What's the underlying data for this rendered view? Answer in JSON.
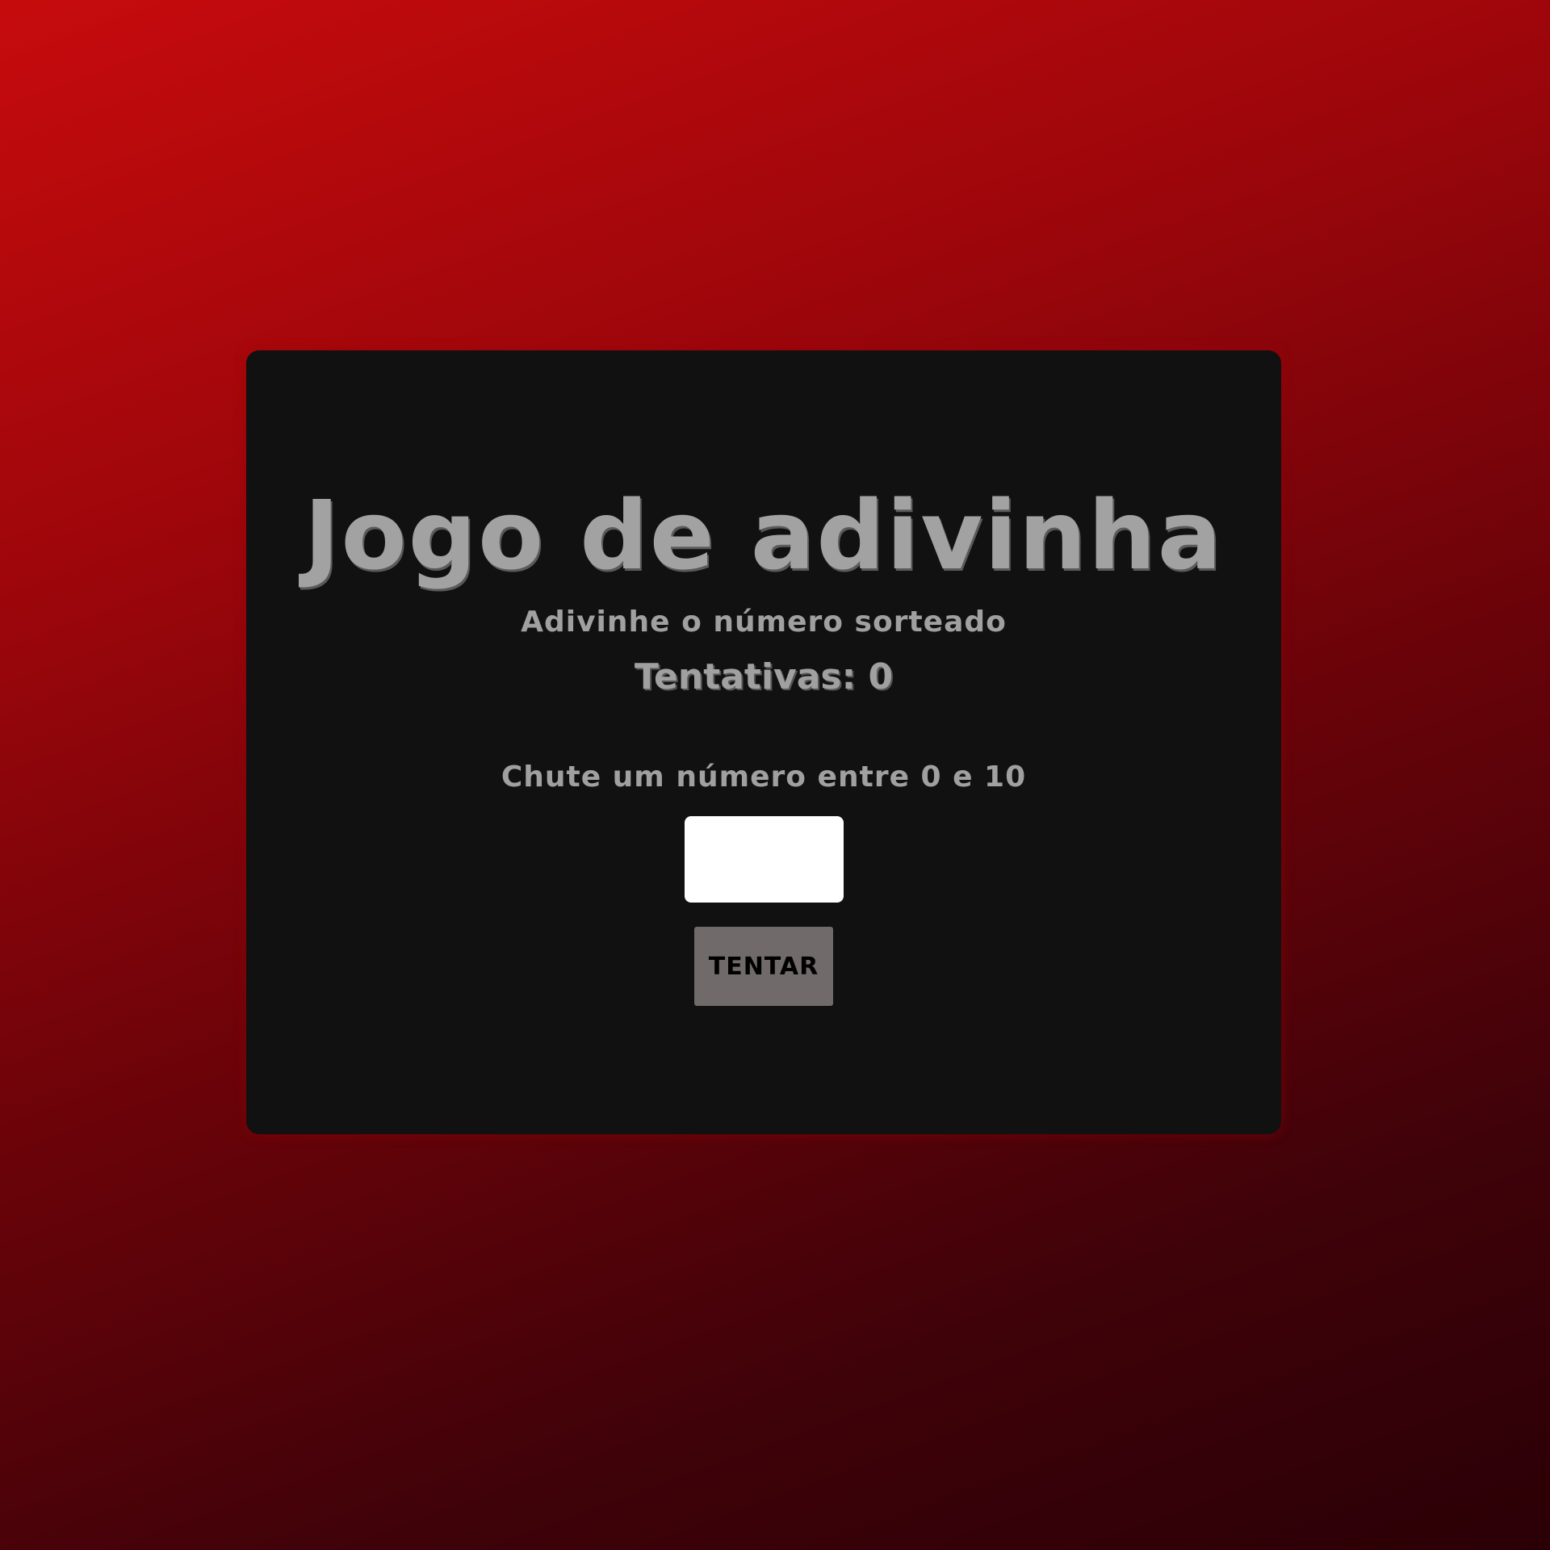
{
  "game": {
    "title": "Jogo de adivinha",
    "subtitle": "Adivinhe o número sorteado",
    "attempts_text": "Tentativas: 0",
    "prompt": "Chute um número entre 0 e 10",
    "input_value": "",
    "button_label": "TENTAR"
  },
  "colors": {
    "background_top": "#c70b0d",
    "background_bottom": "#2a0006",
    "card": "#111111",
    "text": "#a2a2a2",
    "button": "#716a6b",
    "input": "#ffffff"
  }
}
